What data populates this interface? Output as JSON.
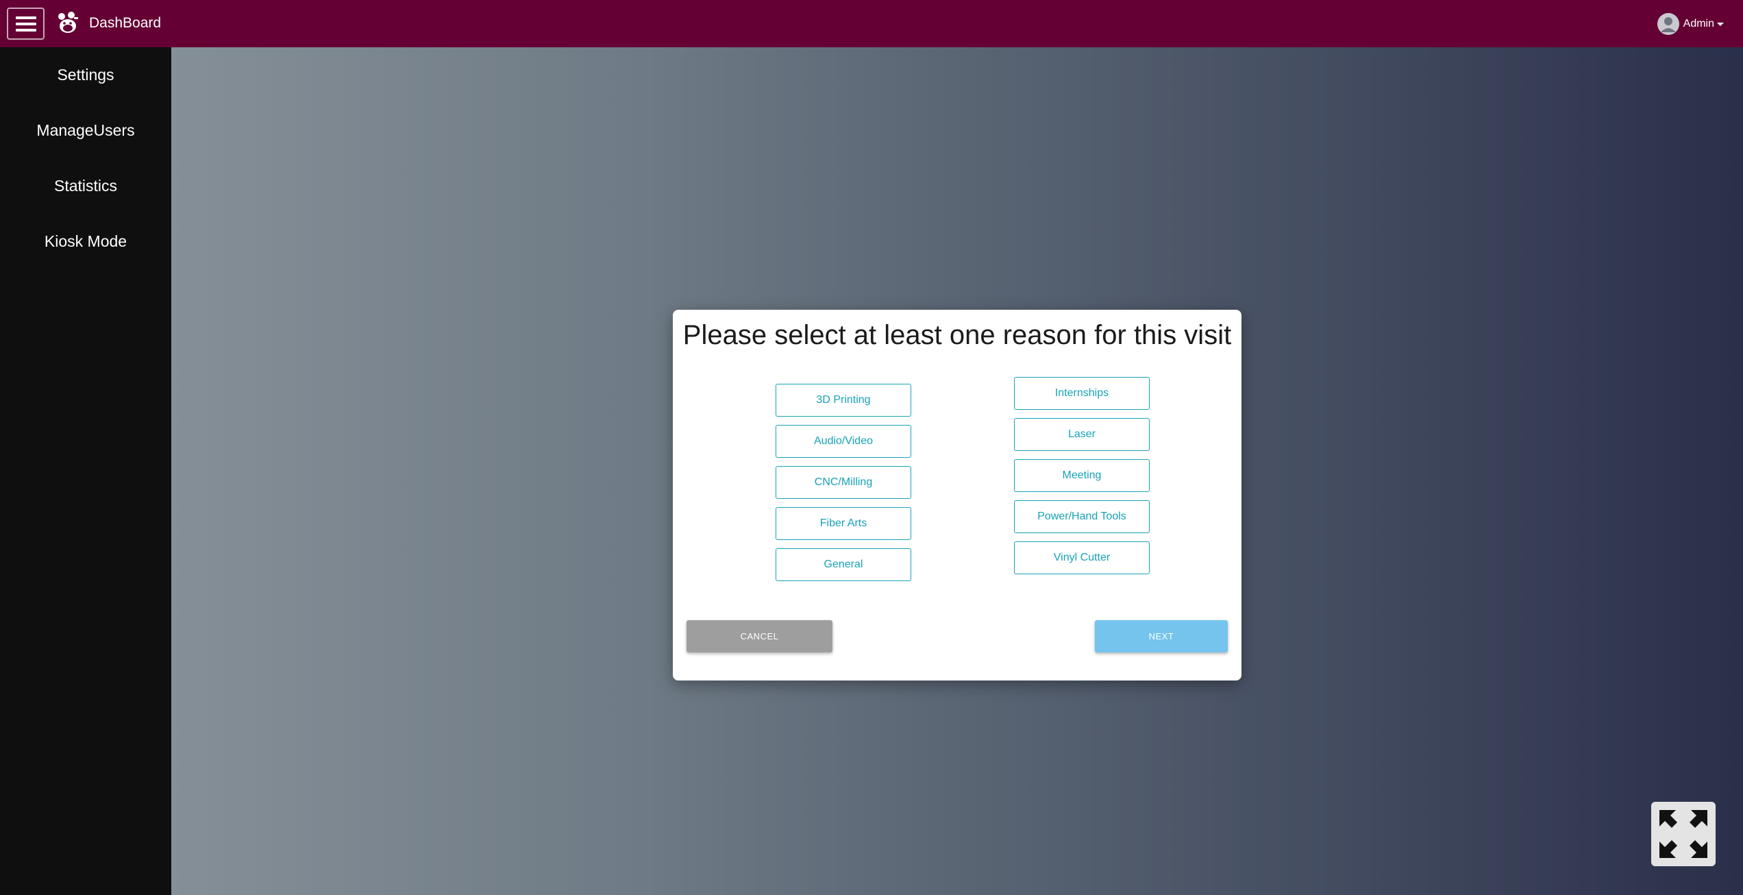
{
  "header": {
    "menu_icon": "hamburger-menu-icon",
    "logo_icon": "bear-mascot-icon",
    "brand": "DashBoard",
    "user": {
      "avatar_icon": "user-avatar-icon",
      "name": "Admin"
    }
  },
  "sidebar": {
    "items": [
      {
        "label": "Settings"
      },
      {
        "label": "ManageUsers"
      },
      {
        "label": "Statistics"
      },
      {
        "label": "Kiosk Mode"
      }
    ]
  },
  "modal": {
    "title": "Please select at least one reason for this visit",
    "left_reasons": [
      "3D Printing",
      "Audio/Video",
      "CNC/Milling",
      "Fiber Arts",
      "General"
    ],
    "right_reasons": [
      "Internships",
      "Laser",
      "Meeting",
      "Power/Hand Tools",
      "Vinyl Cutter"
    ],
    "cancel_label": "CANCEL",
    "next_label": "NEXT"
  },
  "fullscreen": {
    "icon": "expand-fullscreen-icon"
  },
  "colors": {
    "topbar": "#650034",
    "sidebar": "#0f0f0f",
    "reason_accent": "#17a2b8",
    "cancel": "#9e9e9e",
    "next": "#74c4ee"
  }
}
